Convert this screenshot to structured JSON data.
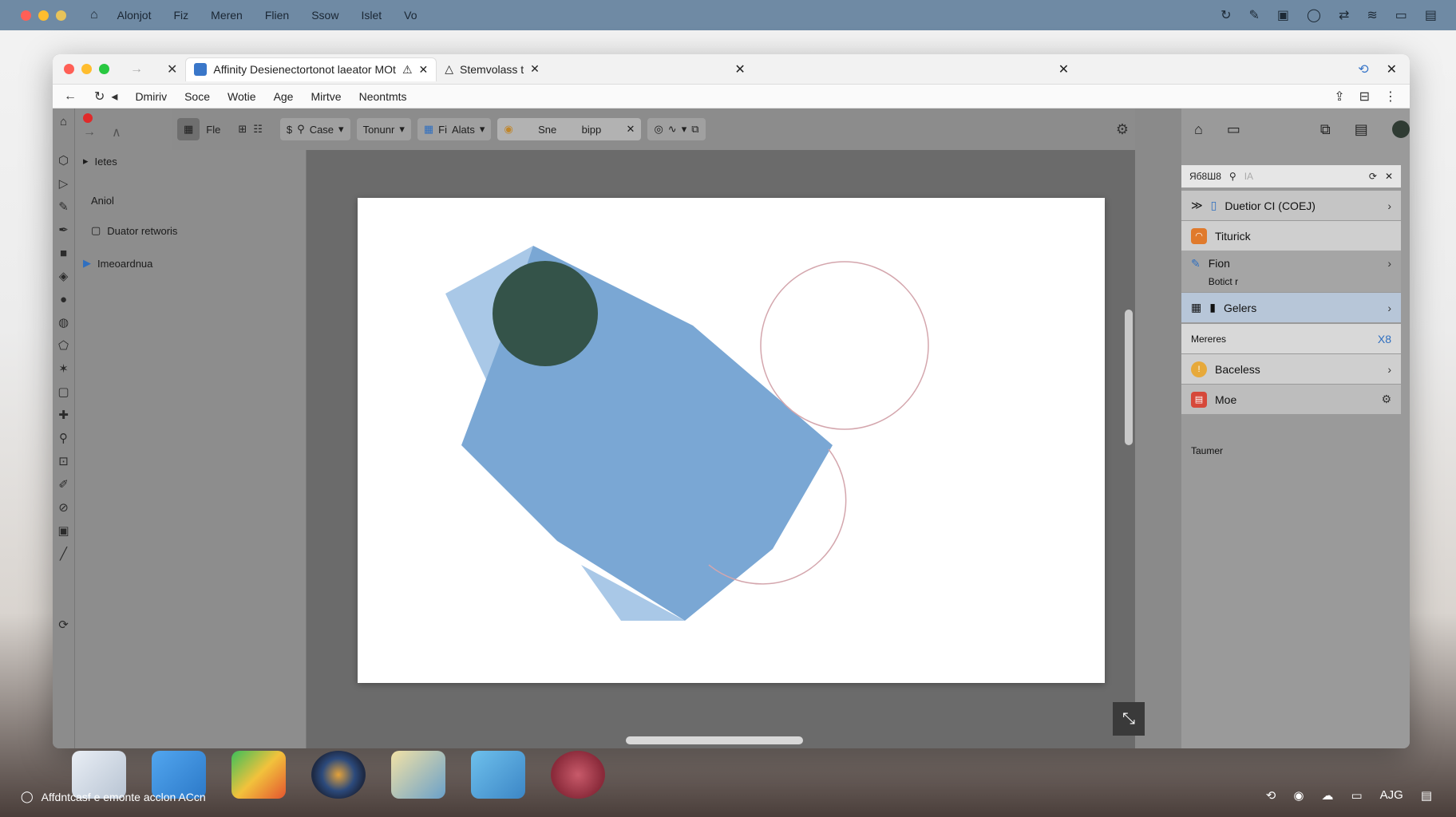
{
  "menubar": {
    "items": [
      "Alonjot",
      "Fiz",
      "Meren",
      "Flien",
      "Ssow",
      "Islet",
      "Vo"
    ],
    "traffic_colors": [
      "#ff5f56",
      "#ffbd2e",
      "#e7c35a"
    ]
  },
  "browser": {
    "tabs": [
      {
        "label": "Affinity Desienectortonot laeator MOt"
      },
      {
        "label": "Stemvolass t"
      }
    ],
    "nav_items": [
      "Dmiriv",
      "Soce",
      "Wotie",
      "Age",
      "Mirtve",
      "Neontmts"
    ]
  },
  "toolbar": {
    "view_label": "Fle",
    "case_label": "Case",
    "tonur_label": "Tonunr",
    "fi_label": "Fi",
    "alats_label": "Alats",
    "search_label": "Sne",
    "search_value": "bipp"
  },
  "left_panel": {
    "header": "Ietes",
    "rows": [
      {
        "label": "Aniol"
      },
      {
        "label": "Duator retworis"
      },
      {
        "label": "Imeoardnua"
      }
    ]
  },
  "right_panel": {
    "search_label": "Яб8Ш8",
    "search_placeholder": "IA",
    "rows": [
      {
        "label": "Duetior CI (COEJ)"
      },
      {
        "label": "Titurick"
      },
      {
        "label": "Fion"
      },
      {
        "label": "Botict r"
      },
      {
        "label": "Gelers"
      },
      {
        "label": "Mereres"
      },
      {
        "label": "Baceless"
      },
      {
        "label": "Moe"
      },
      {
        "label": "Taumer"
      }
    ],
    "mereres_action": "X8"
  },
  "taskbar": {
    "left_text": "Affdntcasf e emonte acclon ACcn",
    "right_text": "AJG"
  },
  "colors": {
    "shape_blue": "#7aa7d4",
    "shape_light_blue": "#a9c8e7",
    "circle_dark": "#345349",
    "circle_outline": "#d4a6ad"
  }
}
